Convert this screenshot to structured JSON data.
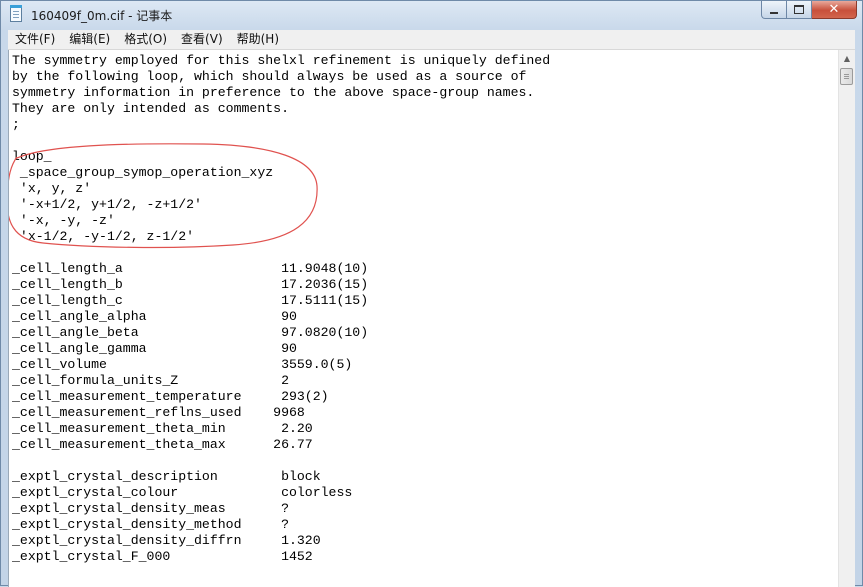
{
  "window": {
    "title": "160409f_0m.cif - 记事本",
    "icon": "notepad-icon",
    "caption": {
      "minimize_icon": "minimize-icon",
      "maximize_icon": "maximize-icon",
      "close_icon": "close-icon",
      "close_glyph": "✕"
    }
  },
  "menu": {
    "items": [
      {
        "label": "文件(F)"
      },
      {
        "label": "编辑(E)"
      },
      {
        "label": "格式(O)"
      },
      {
        "label": "查看(V)"
      },
      {
        "label": "帮助(H)"
      }
    ]
  },
  "colors": {
    "annotation": "#e0524f",
    "titlebar": "#c8d8ea",
    "close_button": "#c8503b"
  },
  "document": {
    "lines": [
      "The symmetry employed for this shelxl refinement is uniquely defined",
      "by the following loop, which should always be used as a source of",
      "symmetry information in preference to the above space-group names.",
      "They are only intended as comments.",
      ";",
      "",
      "loop_",
      " _space_group_symop_operation_xyz",
      " 'x, y, z'",
      " '-x+1/2, y+1/2, -z+1/2'",
      " '-x, -y, -z'",
      " 'x-1/2, -y-1/2, z-1/2'",
      "",
      "_cell_length_a                    11.9048(10)",
      "_cell_length_b                    17.2036(15)",
      "_cell_length_c                    17.5111(15)",
      "_cell_angle_alpha                 90",
      "_cell_angle_beta                  97.0820(10)",
      "_cell_angle_gamma                 90",
      "_cell_volume                      3559.0(5)",
      "_cell_formula_units_Z             2",
      "_cell_measurement_temperature     293(2)",
      "_cell_measurement_reflns_used    9968",
      "_cell_measurement_theta_min       2.20",
      "_cell_measurement_theta_max      26.77",
      "",
      "_exptl_crystal_description        block",
      "_exptl_crystal_colour             colorless",
      "_exptl_crystal_density_meas       ?",
      "_exptl_crystal_density_method     ?",
      "_exptl_crystal_density_diffrn     1.320",
      "_exptl_crystal_F_000              1452",
      ""
    ]
  }
}
